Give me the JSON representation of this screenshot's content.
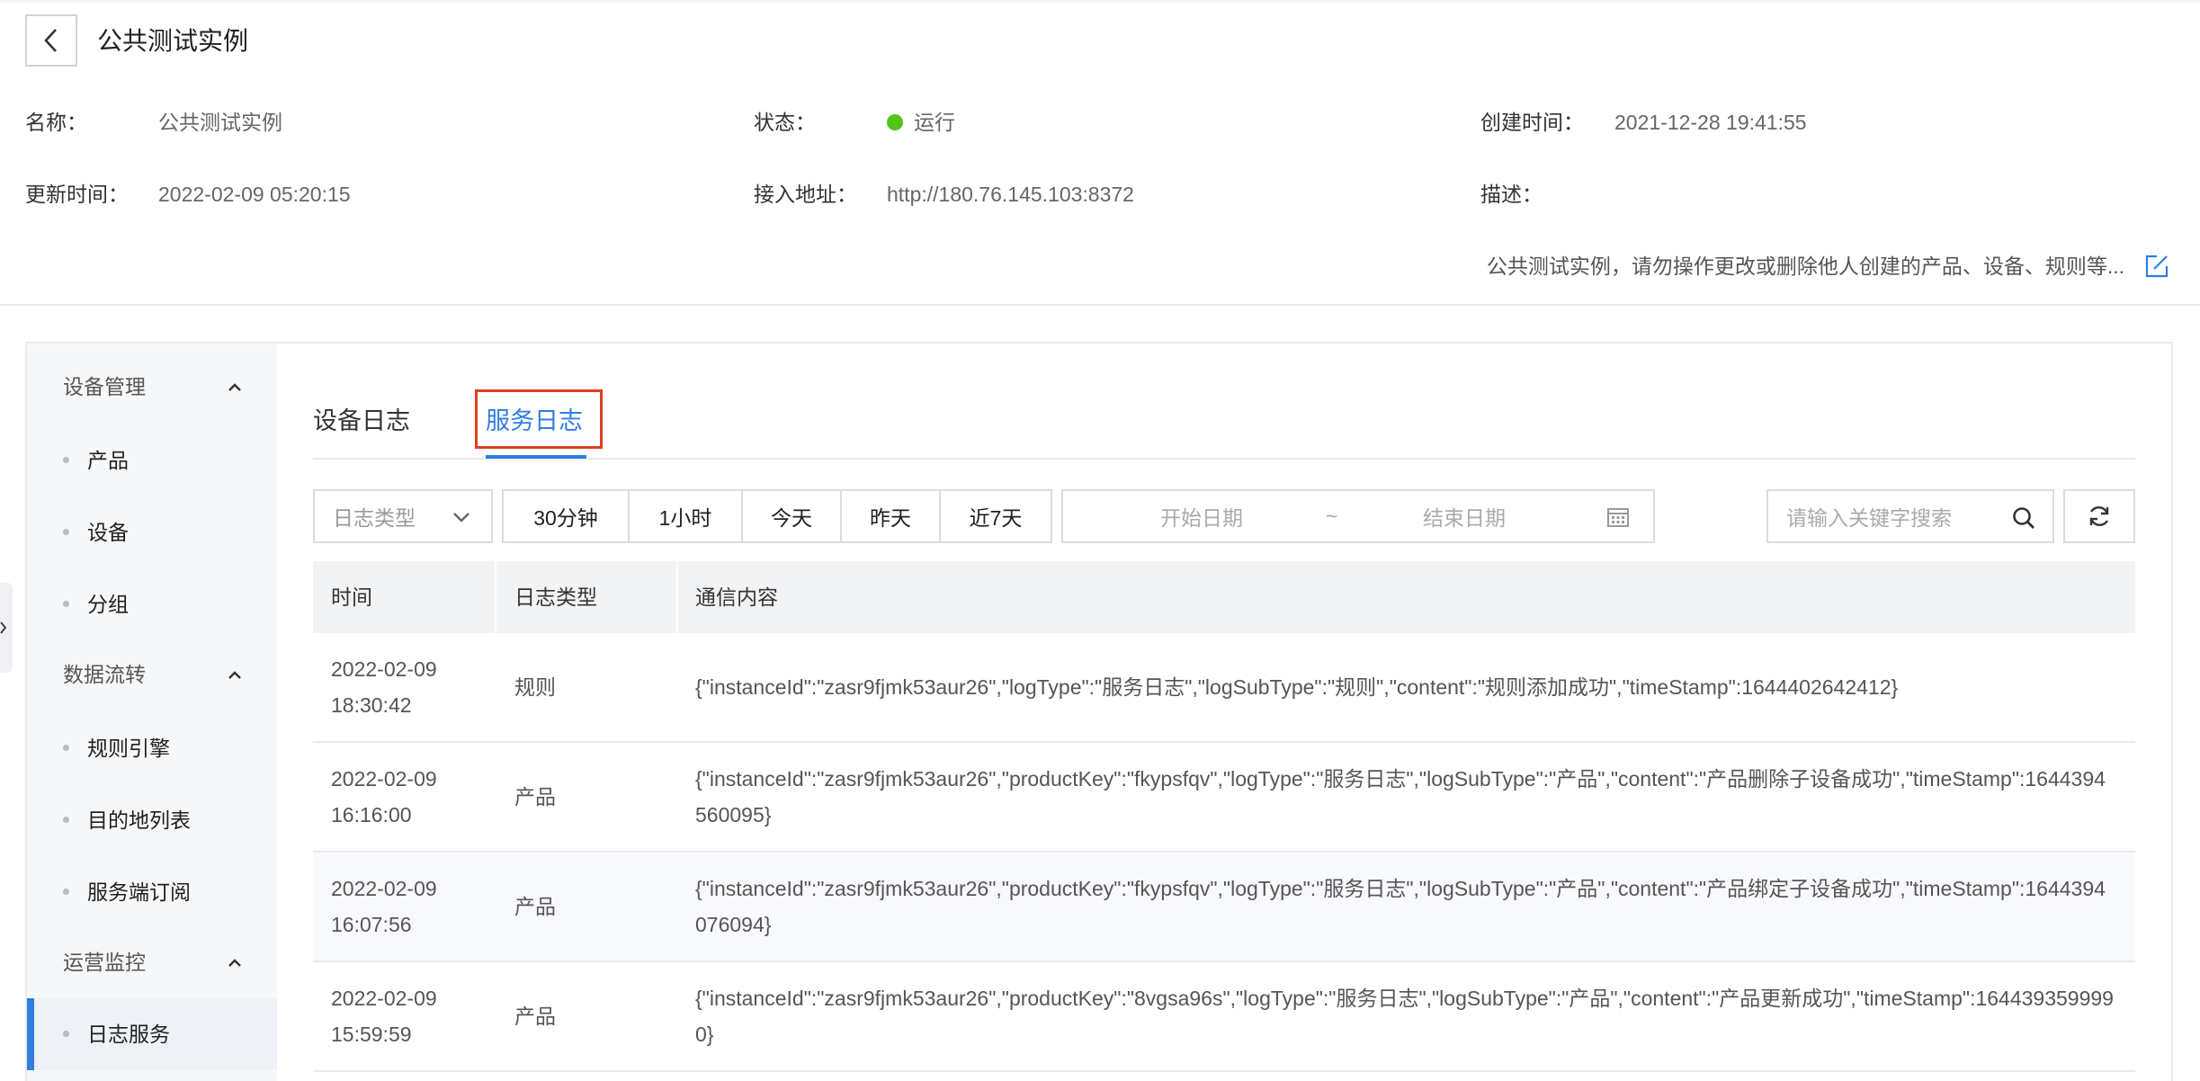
{
  "header": {
    "title": "公共测试实例"
  },
  "info": {
    "name_label": "名称：",
    "name_value": "公共测试实例",
    "status_label": "状态：",
    "status_value": "运行",
    "created_label": "创建时间：",
    "created_value": "2021-12-28 19:41:55",
    "updated_label": "更新时间：",
    "updated_value": "2022-02-09 05:20:15",
    "endpoint_label": "接入地址：",
    "endpoint_value": "http://180.76.145.103:8372",
    "desc_label": "描述：",
    "desc_value": "公共测试实例，请勿操作更改或删除他人创建的产品、设备、规则等..."
  },
  "sidebar": {
    "groups": [
      {
        "label": "设备管理",
        "items": [
          "产品",
          "设备",
          "分组"
        ]
      },
      {
        "label": "数据流转",
        "items": [
          "规则引擎",
          "目的地列表",
          "服务端订阅"
        ]
      },
      {
        "label": "运营监控",
        "items": [
          "日志服务"
        ]
      }
    ],
    "active_item": "日志服务"
  },
  "tabs": {
    "device_log": "设备日志",
    "service_log": "服务日志",
    "active": "服务日志"
  },
  "filters": {
    "log_type_placeholder": "日志类型",
    "ranges": [
      "30分钟",
      "1小时",
      "今天",
      "昨天",
      "近7天"
    ],
    "start_placeholder": "开始日期",
    "range_sep": "~",
    "end_placeholder": "结束日期",
    "search_placeholder": "请输入关键字搜索"
  },
  "table": {
    "columns": [
      "时间",
      "日志类型",
      "通信内容"
    ],
    "rows": [
      {
        "date": "2022-02-09",
        "time": "18:30:42",
        "type": "规则",
        "content": "{\"instanceId\":\"zasr9fjmk53aur26\",\"logType\":\"服务日志\",\"logSubType\":\"规则\",\"content\":\"规则添加成功\",\"timeStamp\":1644402642412}"
      },
      {
        "date": "2022-02-09",
        "time": "16:16:00",
        "type": "产品",
        "content": "{\"instanceId\":\"zasr9fjmk53aur26\",\"productKey\":\"fkypsfqv\",\"logType\":\"服务日志\",\"logSubType\":\"产品\",\"content\":\"产品删除子设备成功\",\"timeStamp\":1644394560095}"
      },
      {
        "date": "2022-02-09",
        "time": "16:07:56",
        "type": "产品",
        "content": "{\"instanceId\":\"zasr9fjmk53aur26\",\"productKey\":\"fkypsfqv\",\"logType\":\"服务日志\",\"logSubType\":\"产品\",\"content\":\"产品绑定子设备成功\",\"timeStamp\":1644394076094}"
      },
      {
        "date": "2022-02-09",
        "time": "15:59:59",
        "type": "产品",
        "content": "{\"instanceId\":\"zasr9fjmk53aur26\",\"productKey\":\"8vgsa96s\",\"logType\":\"服务日志\",\"logSubType\":\"产品\",\"content\":\"产品更新成功\",\"timeStamp\":1644393599990}"
      }
    ]
  },
  "colors": {
    "accent": "#2f7de1",
    "status_running": "#52c41a",
    "highlight_box": "#e0401e"
  }
}
